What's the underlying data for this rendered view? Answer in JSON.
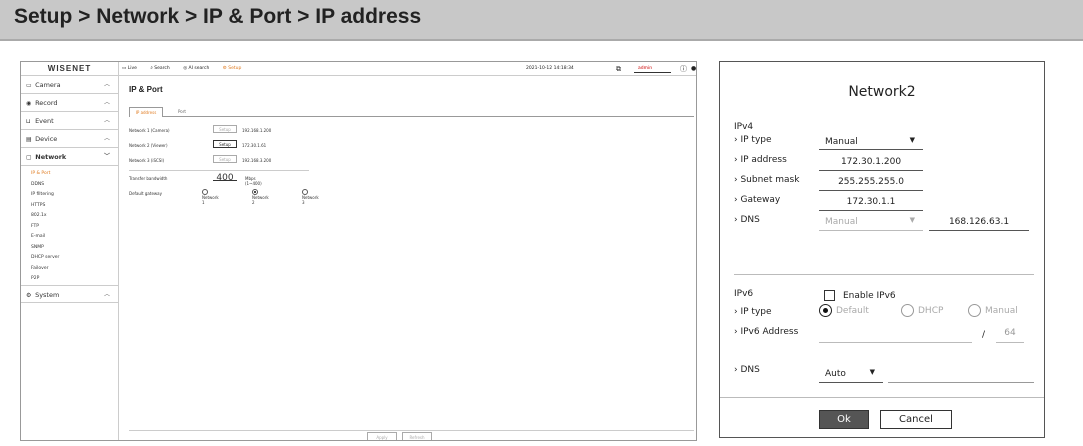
{
  "banner": "Setup > Network > IP & Port > IP address",
  "app": {
    "logo": "WISENET",
    "menu": {
      "camera": "Camera",
      "record": "Record",
      "event": "Event",
      "device": "Device",
      "network": "Network",
      "system": "System"
    },
    "network_sub": [
      "IP & Port",
      "DDNS",
      "IP filtering",
      "HTTPS",
      "802.1x",
      "FTP",
      "E-mail",
      "SNMP",
      "DHCP server",
      "Failover",
      "P2P"
    ],
    "topbar": {
      "live": "Live",
      "search": "Search",
      "ai_search": "AI search",
      "setup": "Setup",
      "datetime": "2021-10-12 14:18:34",
      "user": "admin"
    },
    "page_title": "IP & Port",
    "tabs": [
      "IP address",
      "Port"
    ],
    "rows": [
      {
        "label": "Network 1 (Camera)",
        "button": "Setup",
        "value": "192.168.1.200"
      },
      {
        "label": "Network 2 (Viewer)",
        "button": "Setup",
        "value": "172.30.1.61"
      },
      {
        "label": "Network 3 (iSCSI)",
        "button": "Setup",
        "value": "192.168.3.200"
      }
    ],
    "bandwidth": {
      "label": "Transfer bandwidth",
      "value": "400",
      "unit": "Mbps (1~400)"
    },
    "gateway": {
      "label": "Default gateway",
      "options": [
        "Network 1",
        "Network 2",
        "Network 3"
      ],
      "selected": 1
    },
    "footer": {
      "apply": "Apply",
      "refresh": "Refresh"
    }
  },
  "dialog": {
    "title": "Network2",
    "ipv4": {
      "header": "IPv4",
      "ip_type_label": "IP type",
      "ip_type": "Manual",
      "ip_address_label": "IP address",
      "ip_address": "172.30.1.200",
      "subnet_label": "Subnet mask",
      "subnet": "255.255.255.0",
      "gateway_label": "Gateway",
      "gateway": "172.30.1.1",
      "dns_label": "DNS",
      "dns_mode": "Manual",
      "dns": "168.126.63.1"
    },
    "ipv6": {
      "header": "IPv6",
      "enable_label": "Enable IPv6",
      "ip_type_label": "IP type",
      "options": [
        "Default",
        "DHCP",
        "Manual"
      ],
      "address_label": "IPv6 Address",
      "slash": "/",
      "prefix": "64",
      "dns_label": "DNS",
      "dns_mode": "Auto"
    },
    "ok": "Ok",
    "cancel": "Cancel"
  }
}
